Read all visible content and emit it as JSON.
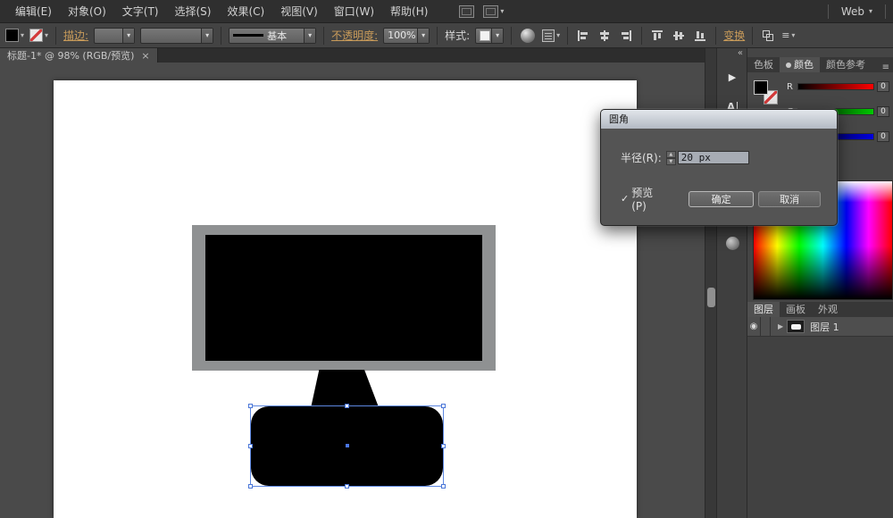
{
  "icons": {
    "collapse": "«",
    "dropdown": "▾",
    "spinner_up": "▲",
    "spinner_down": "▼",
    "close": "×",
    "play": "▶",
    "menu": "≡",
    "eye": "◉",
    "expand": "▶",
    "panel_a": "A"
  },
  "menubar": {
    "items": [
      "编辑(E)",
      "对象(O)",
      "文字(T)",
      "选择(S)",
      "效果(C)",
      "视图(V)",
      "窗口(W)",
      "帮助(H)"
    ],
    "workspace": "Web"
  },
  "toolbar": {
    "stroke_label": "描边:",
    "brush_value": "基本",
    "opacity_label": "不透明度:",
    "opacity_value": "100%",
    "style_label": "样式:",
    "transform_label": "变换"
  },
  "tabbar": {
    "document_title": "标题-1* @ 98% (RGB/预览)"
  },
  "dialog": {
    "title": "圆角",
    "radius_label": "半径(R):",
    "radius_value": "20 px",
    "preview_check": "✓",
    "preview_label": "预览(P)",
    "ok": "确定",
    "cancel": "取消"
  },
  "color_panel": {
    "tabs": [
      "色板",
      "颜色",
      "颜色参考"
    ],
    "channels": [
      {
        "label": "R",
        "value": "0"
      },
      {
        "label": "G",
        "value": "0"
      },
      {
        "label": "B",
        "value": "0"
      }
    ]
  },
  "layers_panel": {
    "tabs": [
      "图层",
      "画板",
      "外观"
    ],
    "layer_name": "图层 1"
  },
  "colors": {
    "selection_blue": "#4a76d8",
    "accent_link": "#c89b5a",
    "artboard": "#ffffff",
    "object_fill": "#000000",
    "monitor_frame": "#8f9192"
  }
}
